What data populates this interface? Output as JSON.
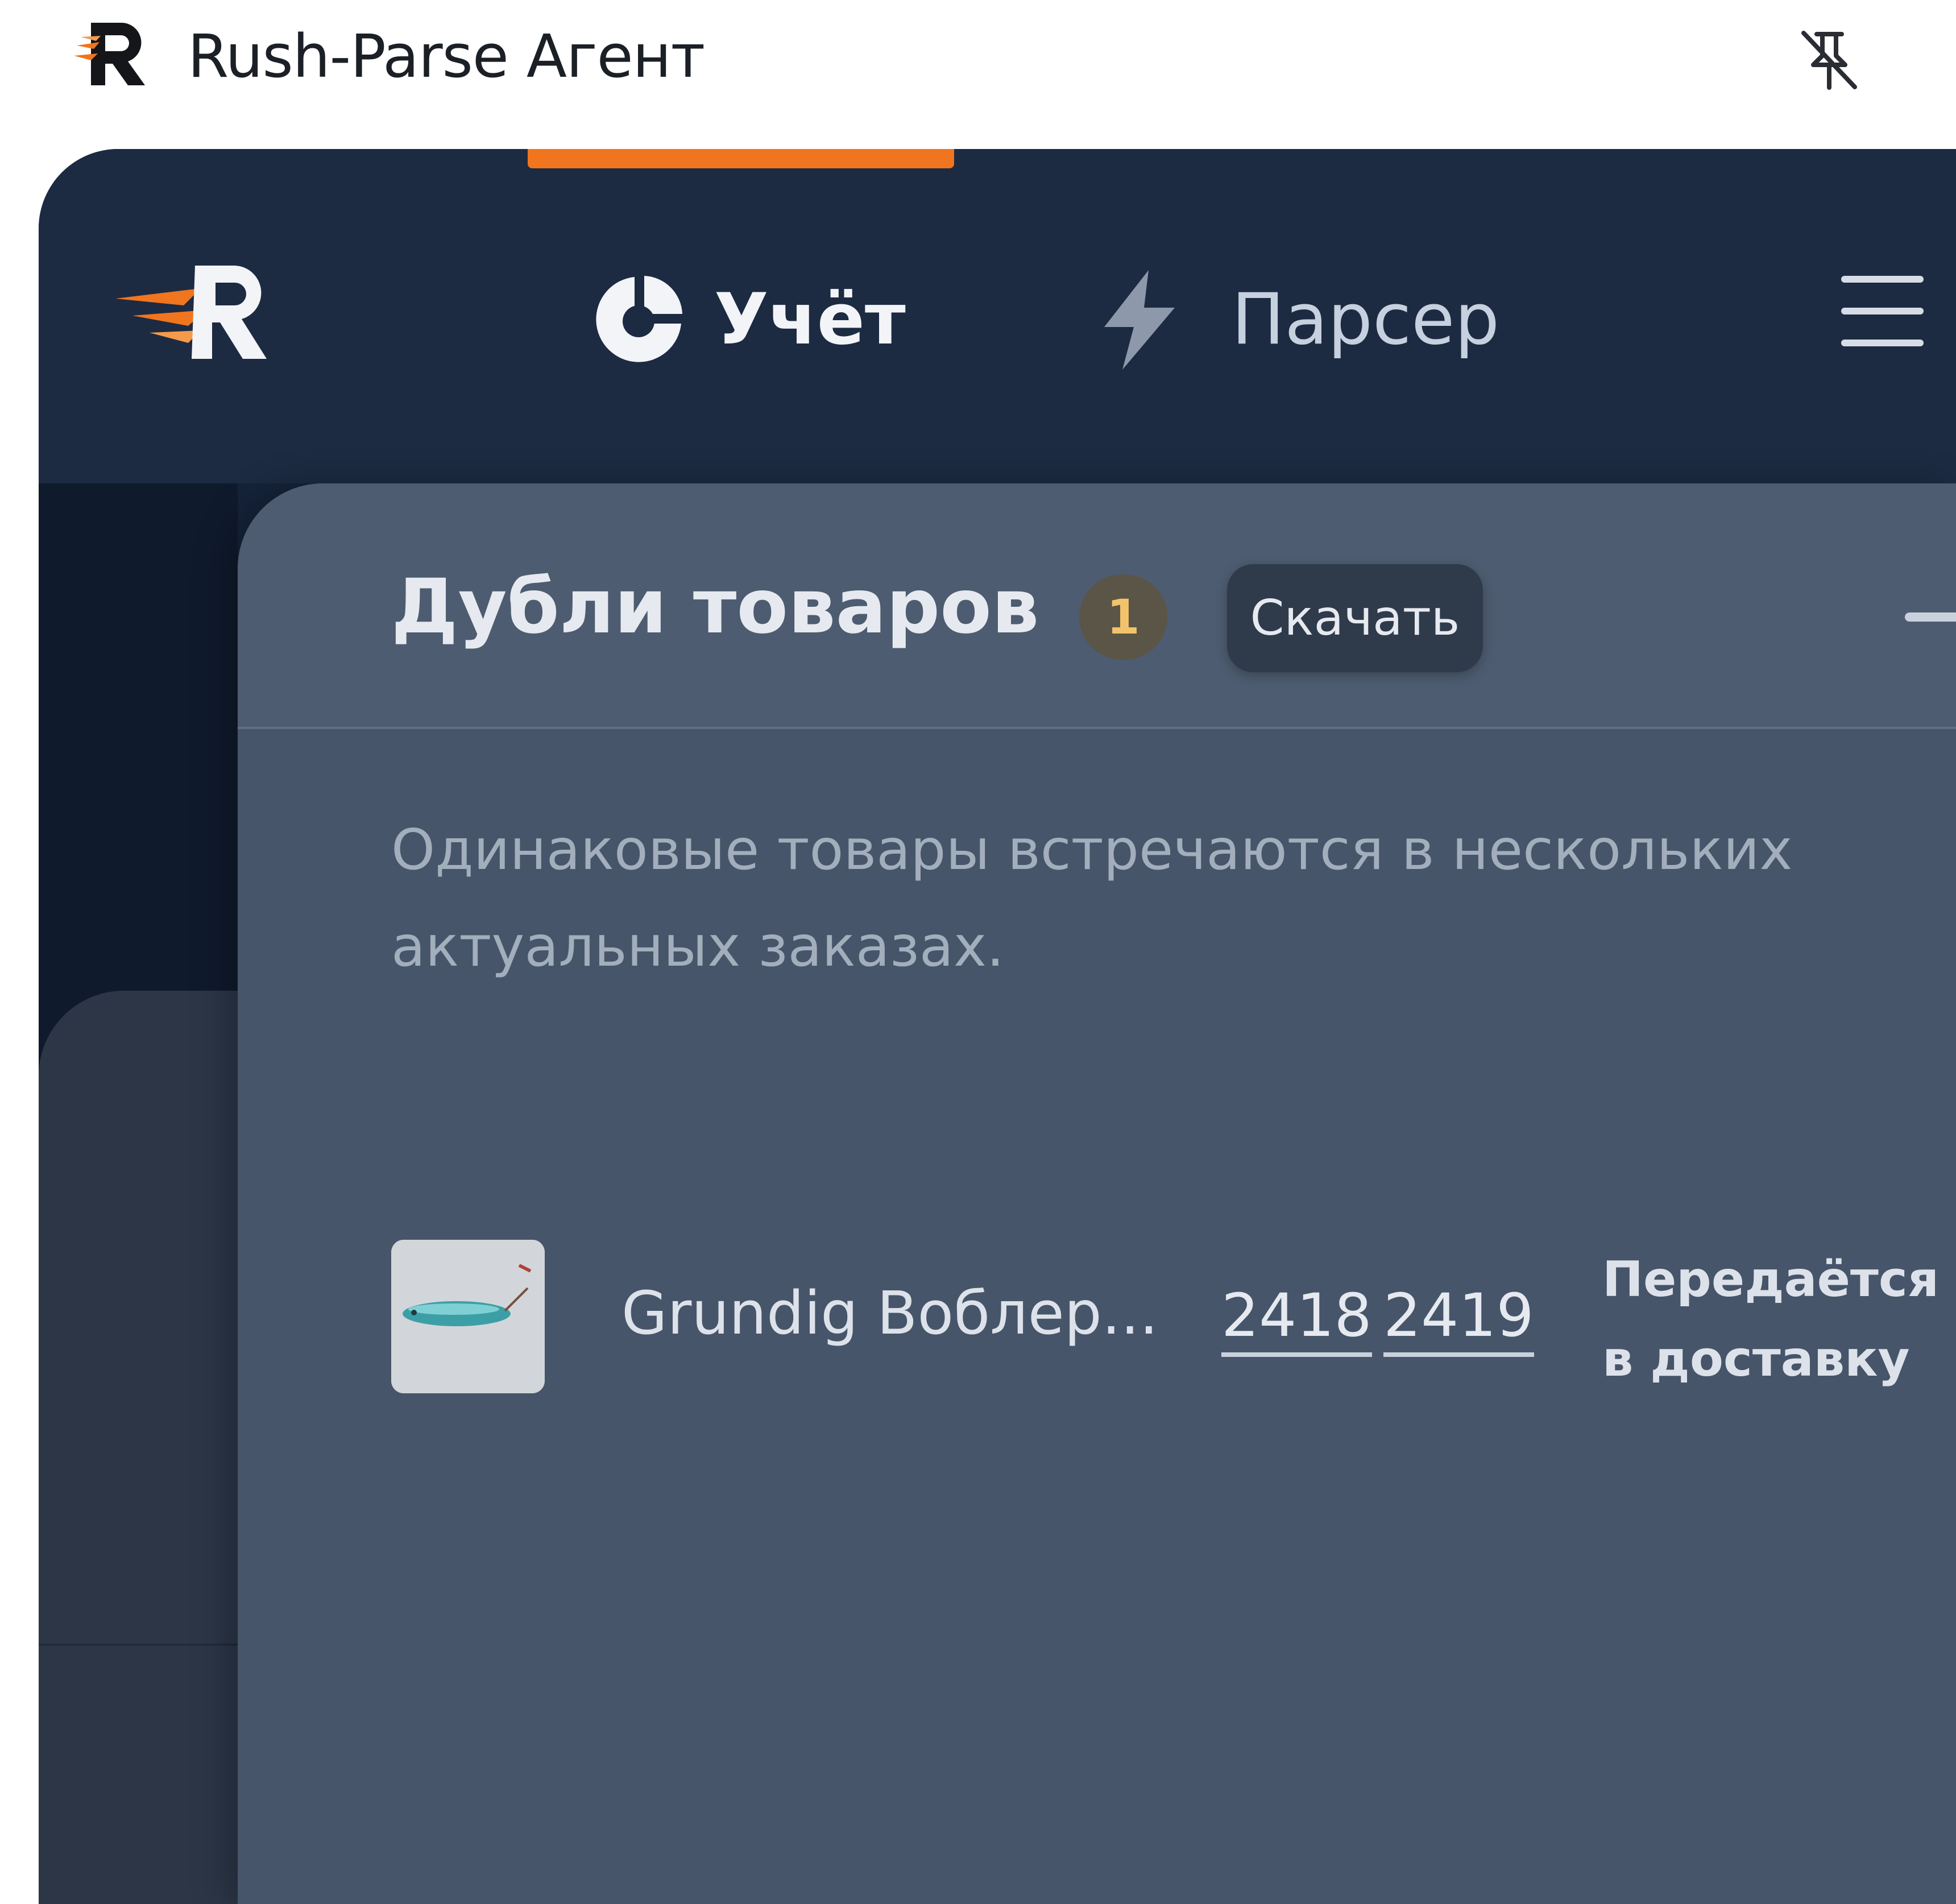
{
  "window": {
    "title": "Rush-Parse Агент",
    "logo_icon": "rush-parse-logo-icon",
    "pin_icon": "pin-off-icon"
  },
  "nav": {
    "items": [
      {
        "label": "Учёт",
        "icon": "pie-chart-icon",
        "active": true
      },
      {
        "label": "Парсер",
        "icon": "lightning-icon",
        "active": false
      }
    ],
    "menu_icon": "hamburger-menu-icon"
  },
  "panel": {
    "title": "Дубли товаров",
    "count": "1",
    "download_label": "Скачать",
    "next_icon": "arrow-right-icon",
    "description": "Одинаковые товары встречаются в нескольких актуальных заказах.",
    "items": [
      {
        "thumbnail_icon": "fishing-lure-image",
        "name": "Grundig Воблер...",
        "orders": [
          "2418",
          "2419"
        ],
        "status": "Передаётся в доставку"
      }
    ]
  },
  "colors": {
    "accent": "#f0751e",
    "header_bg": "#1c2b42",
    "panel_bg": "#465569",
    "badge_text": "#f3c36b"
  }
}
